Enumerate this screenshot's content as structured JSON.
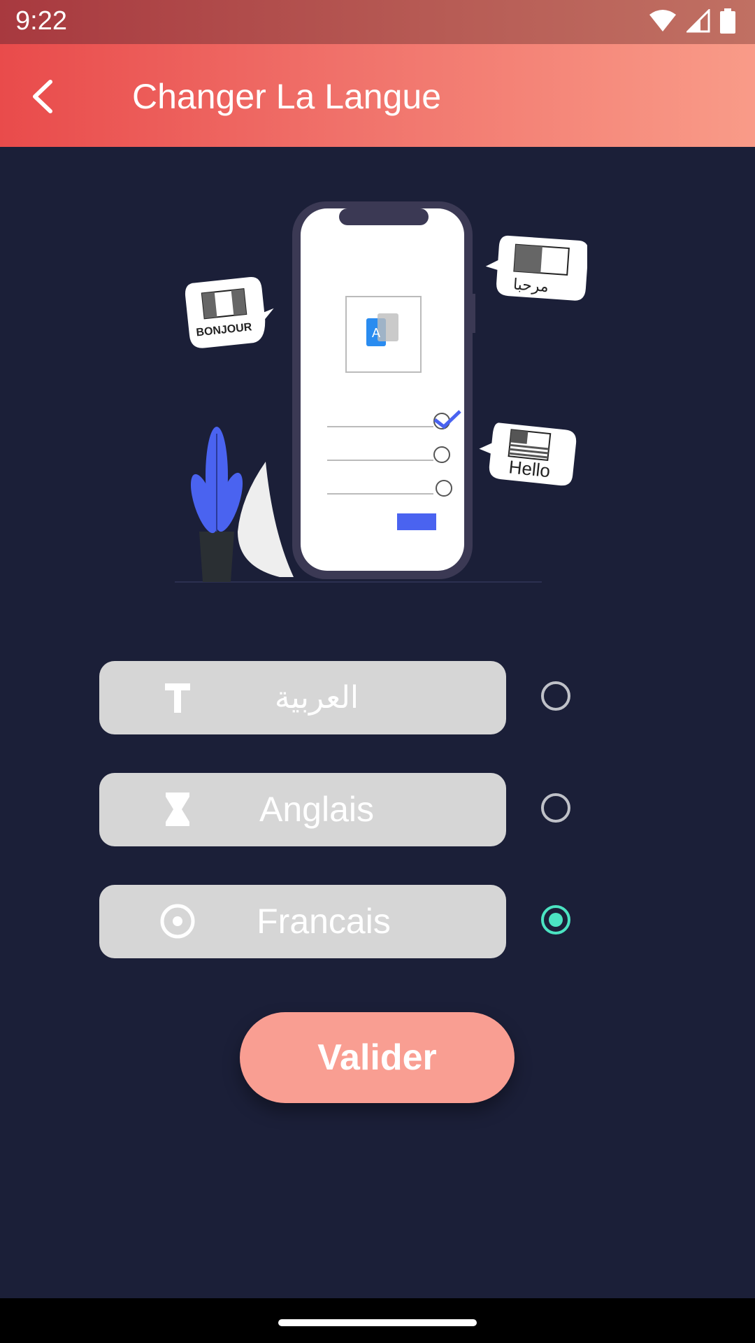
{
  "status_bar": {
    "time": "9:22",
    "icons": [
      "wifi-icon",
      "cell-signal-icon",
      "battery-icon"
    ]
  },
  "app_bar": {
    "title": "Changer La Langue",
    "back_icon": "chevron-left-icon"
  },
  "illustration": {
    "bubbles": [
      "BONJOUR",
      "مرحبا",
      "Hello"
    ]
  },
  "languages": [
    {
      "label": "العربية",
      "icon": "text-t-icon",
      "selected": false
    },
    {
      "label": "Anglais",
      "icon": "hourglass-icon",
      "selected": false
    },
    {
      "label": "Francais",
      "icon": "target-icon",
      "selected": true
    }
  ],
  "validate_button": {
    "label": "Valider"
  },
  "colors": {
    "app_bar_start": "#e94b4b",
    "app_bar_end": "#f99b88",
    "background": "#1b1f38",
    "card": "#d6d6d6",
    "radio_selected": "#4be3c2",
    "button": "#f99e92"
  }
}
